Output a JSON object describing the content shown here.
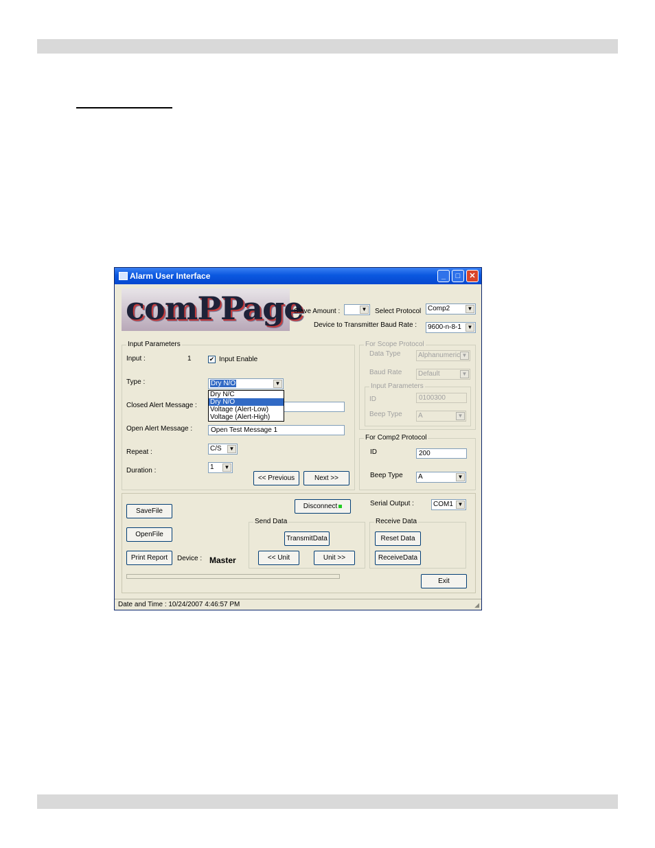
{
  "window": {
    "title": "Alarm User Interface",
    "minimize_glyph": "_",
    "maximize_glyph": "□",
    "close_glyph": "✕"
  },
  "logo": {
    "text": "comPPage"
  },
  "header": {
    "slave_amount_label": "Slave Amount :",
    "slave_amount_value": "",
    "select_protocol_label": "Select Protocol",
    "protocol_value": "Comp2",
    "baud_label": "Device to Transmitter Baud Rate :",
    "baud_value": "9600-n-8-1"
  },
  "input_parameters": {
    "title": "Input Parameters",
    "input_label": "Input :",
    "input_value": "1",
    "input_enable_label": "Input Enable",
    "input_enable_checked": "✔",
    "type_label": "Type :",
    "type_value": "Dry N/O",
    "type_options": [
      "Dry N/C",
      "Dry N/O",
      "Voltage (Alert-Low)",
      "Voltage (Alert-High)"
    ],
    "closed_alert_label": "Closed Alert Message :",
    "closed_alert_value": "",
    "open_alert_label": "Open Alert Message :",
    "open_alert_value": "Open Test Message 1",
    "repeat_label": "Repeat :",
    "repeat_value": "C/S",
    "duration_label": "Duration :",
    "duration_value": "1",
    "previous_label": "<< Previous",
    "next_label": "Next >>"
  },
  "scope_protocol": {
    "title": "For Scope Protocol",
    "data_type_label": "Data Type",
    "data_type_value": "Alphanumeric",
    "baud_rate_label": "Baud Rate",
    "baud_rate_value": "Default",
    "sub_title": "Input Parameters",
    "id_label": "ID",
    "id_value": "0100300",
    "beep_type_label": "Beep Type",
    "beep_type_value": "A"
  },
  "comp2_protocol": {
    "title": "For Comp2 Protocol",
    "id_label": "ID",
    "id_value": "200",
    "beep_type_label": "Beep Type",
    "beep_type_value": "A"
  },
  "bottom": {
    "save_file": "SaveFile",
    "open_file": "OpenFile",
    "print_report": "Print Report",
    "device_label": "Device :",
    "device_value": "Master",
    "disconnect": "Disconnect",
    "serial_output_label": "Serial Output :",
    "serial_output_value": "COM1",
    "send_data_title": "Send Data",
    "transmit_data": "TransmitData",
    "prev_unit": "<< Unit",
    "next_unit": "Unit >>",
    "receive_data_title": "Receive Data",
    "reset_data": "Reset Data",
    "receive_data": "ReceiveData",
    "exit": "Exit"
  },
  "status": {
    "text": "Date and Time : 10/24/2007 4:46:57 PM"
  },
  "colors": {
    "titlebar": "#0b58e0",
    "window_bg": "#ece9d8",
    "selection": "#316ac5",
    "led": "#22cc22"
  }
}
